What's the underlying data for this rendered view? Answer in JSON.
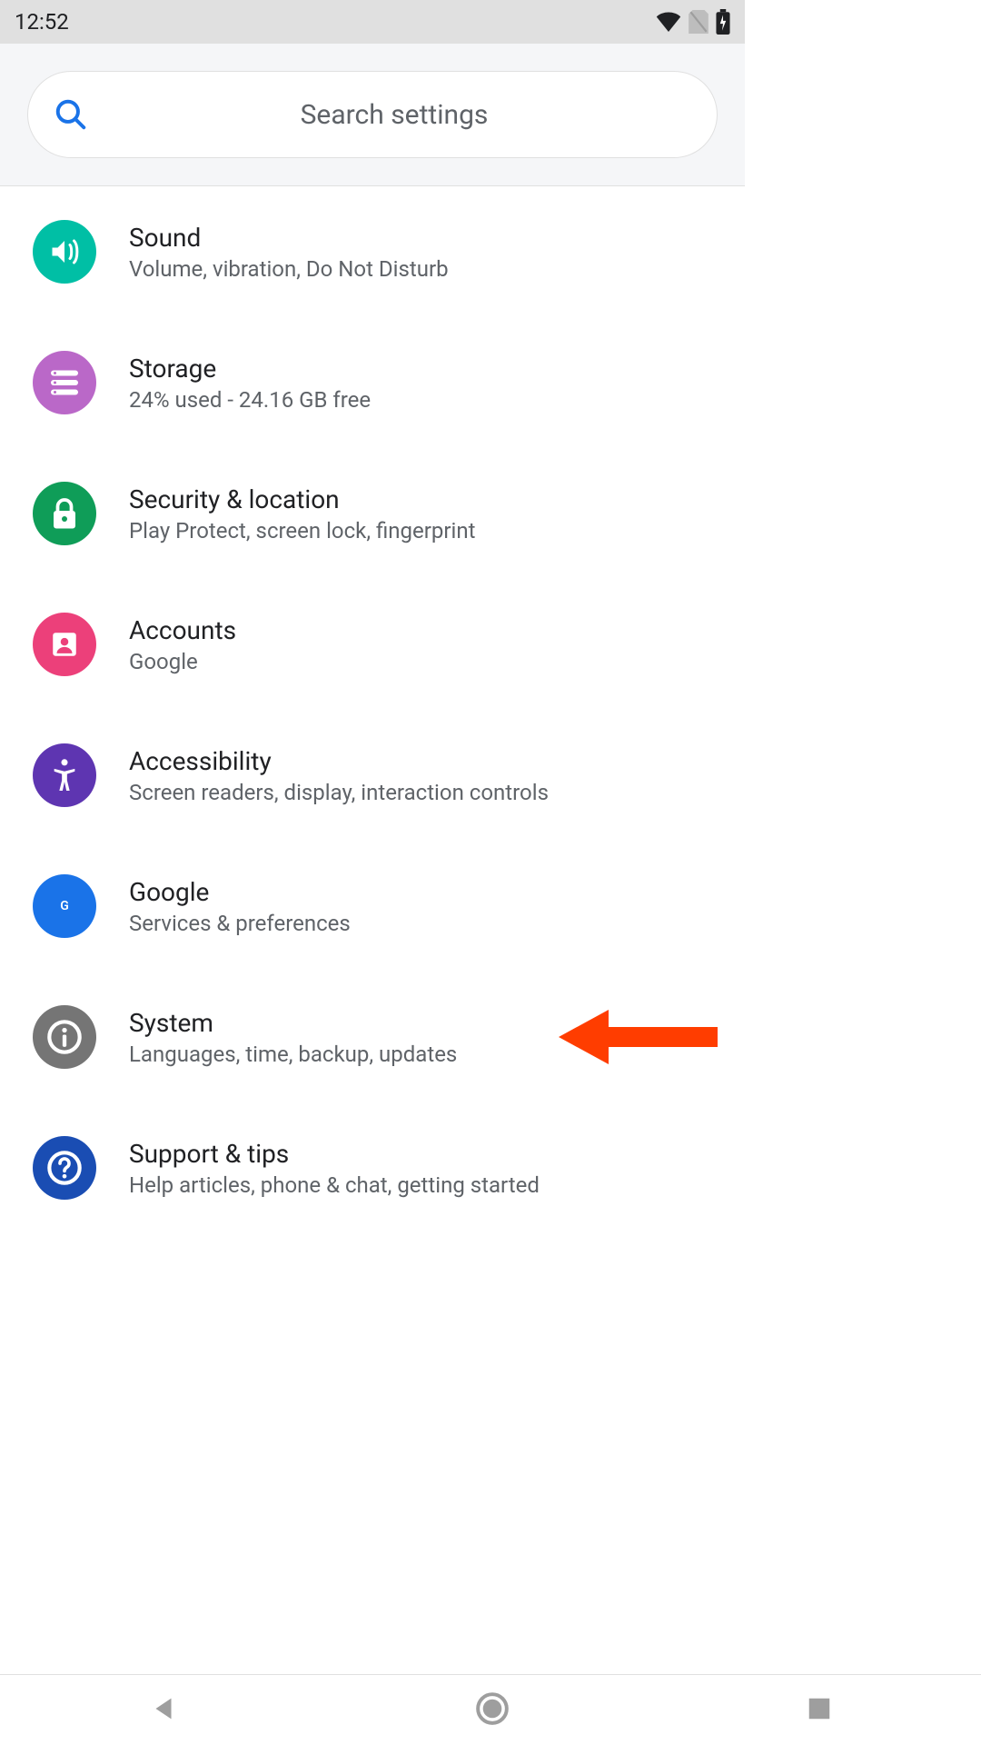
{
  "status": {
    "time": "12:52"
  },
  "search": {
    "placeholder": "Search settings"
  },
  "items": [
    {
      "title": "Sound",
      "subtitle": "Volume, vibration, Do Not Disturb",
      "color": "#00bfa5",
      "icon": "sound"
    },
    {
      "title": "Storage",
      "subtitle": "24% used - 24.16 GB free",
      "color": "#ba68c8",
      "icon": "storage"
    },
    {
      "title": "Security & location",
      "subtitle": "Play Protect, screen lock, fingerprint",
      "color": "#0f9d58",
      "icon": "lock"
    },
    {
      "title": "Accounts",
      "subtitle": "Google",
      "color": "#ec407a",
      "icon": "account"
    },
    {
      "title": "Accessibility",
      "subtitle": "Screen readers, display, interaction controls",
      "color": "#5e35b1",
      "icon": "accessibility"
    },
    {
      "title": "Google",
      "subtitle": "Services & preferences",
      "color": "#1a73e8",
      "icon": "google"
    },
    {
      "title": "System",
      "subtitle": "Languages, time, backup, updates",
      "color": "#757575",
      "icon": "info"
    },
    {
      "title": "Support & tips",
      "subtitle": "Help articles, phone & chat, getting started",
      "color": "#1a4db3",
      "icon": "help"
    }
  ],
  "annotation": {
    "arrow_target_index": 6,
    "arrow_color": "#ff3d00"
  }
}
